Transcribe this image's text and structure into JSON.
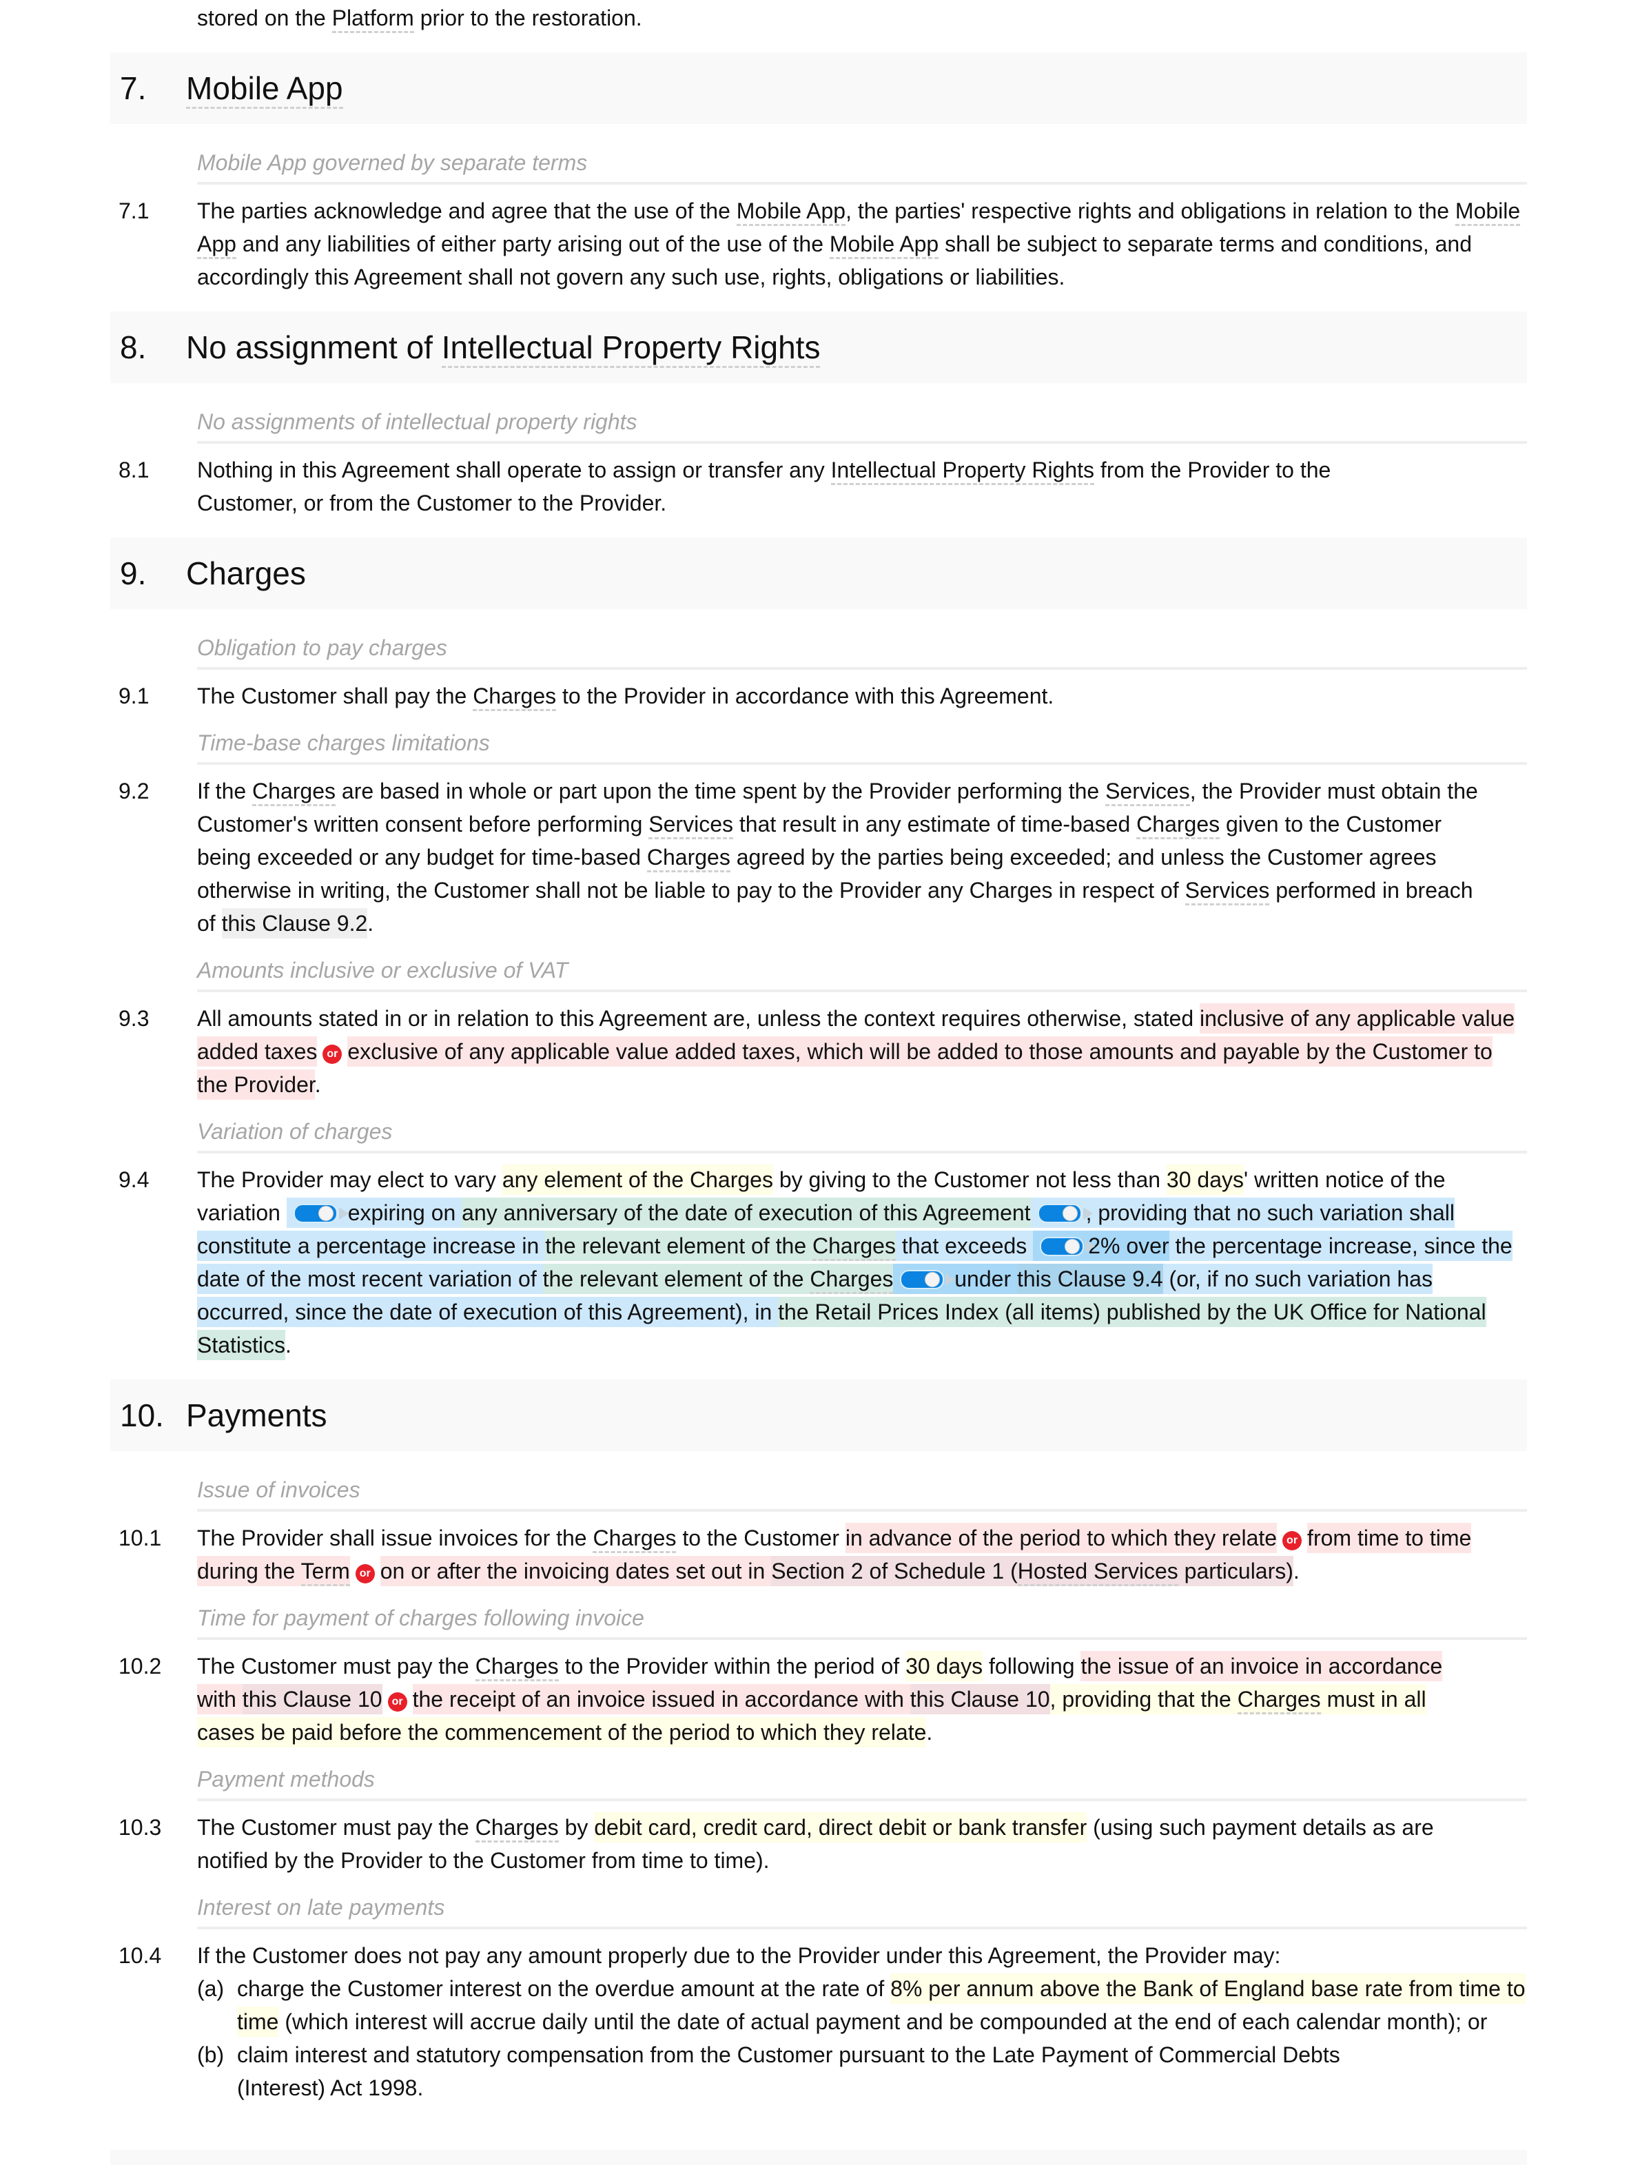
{
  "intro": {
    "before": "stored on the ",
    "term": "Platform",
    "after": " prior to the restoration."
  },
  "sections": [
    {
      "number": "7.",
      "title_term": "Mobile App",
      "subheading": "Mobile App governed by separate terms",
      "clause": {
        "number": "7.1",
        "parts": [
          "The parties acknowledge and agree that the use of the ",
          "Mobile App",
          ", the parties' respective rights and obligations in relation to the ",
          "Mobile App",
          " and any liabilities of either party arising out of the use of the ",
          "Mobile App",
          " shall be subject to separate terms and conditions, and accordingly this Agreement shall not govern any such use, rights, obligations or liabilities."
        ]
      }
    },
    {
      "number": "8.",
      "title_prefix": "No assignment of ",
      "title_term": "Intellectual Property Rights",
      "subheading": "No assignments of intellectual property rights",
      "clause": {
        "number": "8.1",
        "parts": [
          "Nothing in this Agreement shall operate to assign or transfer any ",
          "Intellectual Property Rights",
          " from the Provider to the Customer, or from the Customer to the Provider."
        ]
      }
    },
    {
      "number": "9.",
      "title": "Charges",
      "clauses": [
        {
          "subheading": "Obligation to pay charges",
          "number": "9.1",
          "parts": [
            "The Customer shall pay the ",
            "Charges",
            " to the Provider in accordance with this Agreement."
          ]
        },
        {
          "subheading": "Time-base charges limitations",
          "number": "9.2",
          "parts": [
            "If the ",
            "Charges",
            " are based in whole or part upon the time spent by the Provider performing the ",
            "Services",
            ", the Provider must obtain the Customer's written consent before performing ",
            "Services",
            " that result in any estimate of time-based ",
            "Charges",
            " given to the Customer being exceeded or any budget for time-based ",
            "Charges",
            " agreed by the parties being exceeded; and unless the Customer agrees otherwise in writing, the Customer shall not be liable to pay to the Provider any Charges in respect of ",
            "Services",
            " performed in breach of ",
            "this Clause 9.2",
            "."
          ]
        },
        {
          "subheading": "Amounts inclusive or exclusive of VAT",
          "number": "9.3",
          "parts": [
            "All amounts stated in or in relation to this Agreement are, unless the context requires otherwise, stated ",
            "inclusive of any applicable value added taxes",
            "or",
            "exclusive of any applicable value added taxes, which will be added to those amounts and payable by the Customer to the Provider",
            "."
          ]
        },
        {
          "subheading": "Variation of charges",
          "number": "9.4",
          "parts": [
            "The Provider may elect to vary ",
            "any element of the Charges",
            " by giving to the Customer not less than ",
            "30 days",
            "' written notice of the variation ",
            " expiring on ",
            "any anniversary of the date of execution of this Agreement",
            ", providing that no such variation shall constitute a percentage increase in ",
            "the relevant element of the ",
            "Charges",
            " that exceeds ",
            "2%",
            " over",
            " the percentage increase, since the date of the most recent variation of ",
            "the relevant element of the ",
            "Charges",
            " under ",
            "this Clause 9.4",
            " (or, if no such variation has occurred, since the date of execution of this Agreement), in ",
            "the Retail Prices Index (all items) published by the UK Office for National Statistics",
            "."
          ],
          "toggles": [
            {
              "name": "variation-expiry-toggle",
              "on": true
            },
            {
              "name": "anniversary-toggle",
              "on": true
            },
            {
              "name": "percentage-cap-toggle",
              "on": true
            },
            {
              "name": "recent-variation-toggle",
              "on": true
            }
          ]
        }
      ]
    },
    {
      "number": "10.",
      "title": "Payments",
      "clauses": [
        {
          "subheading": "Issue of invoices",
          "number": "10.1",
          "parts": [
            "The Provider shall issue invoices for the ",
            "Charges",
            " to the Customer ",
            "in advance of the period to which they relate",
            "or",
            "from time to time during the ",
            "Term",
            "or",
            "on or after the invoicing dates set out in ",
            "Section 2 of Schedule 1 (",
            "Hosted Services",
            " particulars)",
            "."
          ]
        },
        {
          "subheading": "Time for payment of charges following invoice",
          "number": "10.2",
          "parts": [
            "The Customer must pay the ",
            "Charges",
            " to the Provider within the period of ",
            "30 days",
            " following ",
            "the issue of an invoice in accordance with ",
            "this Clause 10",
            "or",
            "the receipt of an invoice issued in accordance with ",
            "this Clause 10",
            ", providing that the ",
            "Charges",
            " must in all cases be paid before the commencement of the period to which they relate",
            "."
          ]
        },
        {
          "subheading": "Payment methods",
          "number": "10.3",
          "parts": [
            "The Customer must pay the ",
            "Charges",
            " by ",
            "debit card, credit card, direct debit or bank transfer",
            " (using such payment details as are notified by the Provider to the Customer from time to time)."
          ]
        },
        {
          "subheading": "Interest on late payments",
          "number": "10.4",
          "lead": "If the Customer does not pay any amount properly due to the Provider under this Agreement, the Provider may:",
          "items": [
            {
              "label": "(a)",
              "parts": [
                "charge the Customer interest on the overdue amount at the rate of ",
                "8% per annum above the Bank of England base rate from time to time",
                " (which interest will accrue daily until the date of actual payment and be compounded at the end of each calendar month); or"
              ]
            },
            {
              "label": "(b)",
              "parts": [
                "claim interest and statutory compensation from the Customer pursuant to the Late Payment of Commercial Debts (Interest) Act 1998."
              ]
            }
          ]
        }
      ]
    }
  ],
  "colors": {
    "heading_band": "#f9f9f9",
    "subheading_text": "#a6a6a6",
    "option_red": "#fde5e6",
    "variable_yellow": "#fffee6",
    "optional_blue": "#cde8fb",
    "optional_green": "#d3ebe3",
    "or_badge": "#e8202a",
    "toggle_on": "#0a84e0"
  }
}
